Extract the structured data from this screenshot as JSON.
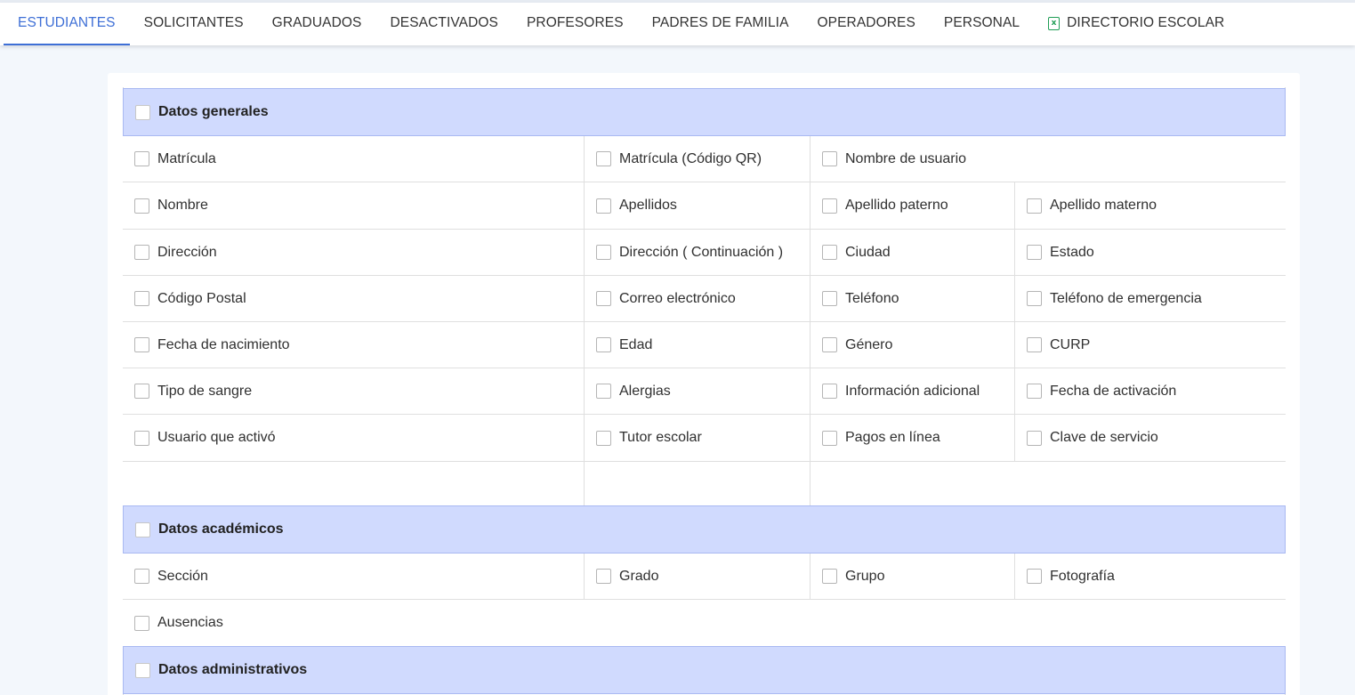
{
  "tabs": [
    {
      "label": "ESTUDIANTES",
      "active": true
    },
    {
      "label": "SOLICITANTES"
    },
    {
      "label": "GRADUADOS"
    },
    {
      "label": "DESACTIVADOS"
    },
    {
      "label": "PROFESORES"
    },
    {
      "label": "PADRES DE FAMILIA"
    },
    {
      "label": "OPERADORES"
    },
    {
      "label": "PERSONAL"
    },
    {
      "label": "DIRECTORIO ESCOLAR",
      "icon": "excel-file-icon"
    }
  ],
  "sections": {
    "general": {
      "title": "Datos generales",
      "rows": [
        [
          "Matrícula",
          "Matrícula (Código QR)",
          "Nombre de usuario"
        ],
        [
          "Nombre",
          "Apellidos",
          "Apellido paterno",
          "Apellido materno"
        ],
        [
          "Dirección",
          "Dirección ( Continuación )",
          "Ciudad",
          "Estado"
        ],
        [
          "Código Postal",
          "Correo electrónico",
          "Teléfono",
          "Teléfono de emergencia"
        ],
        [
          "Fecha de nacimiento",
          "Edad",
          "Género",
          "CURP"
        ],
        [
          "Tipo de sangre",
          "Alergias",
          "Información adicional",
          "Fecha de activación"
        ],
        [
          "Usuario que activó",
          "Tutor escolar",
          "Pagos en línea",
          "Clave de servicio"
        ]
      ]
    },
    "academic": {
      "title": "Datos académicos",
      "rows": [
        [
          "Sección",
          "Grado",
          "Grupo",
          "Fotografía"
        ],
        [
          "Ausencias"
        ]
      ]
    },
    "admin": {
      "title": "Datos administrativos"
    }
  },
  "colors": {
    "accent": "#3e6fd6",
    "section_bg": "#d0dafe",
    "excel_green": "#1f9d55"
  }
}
